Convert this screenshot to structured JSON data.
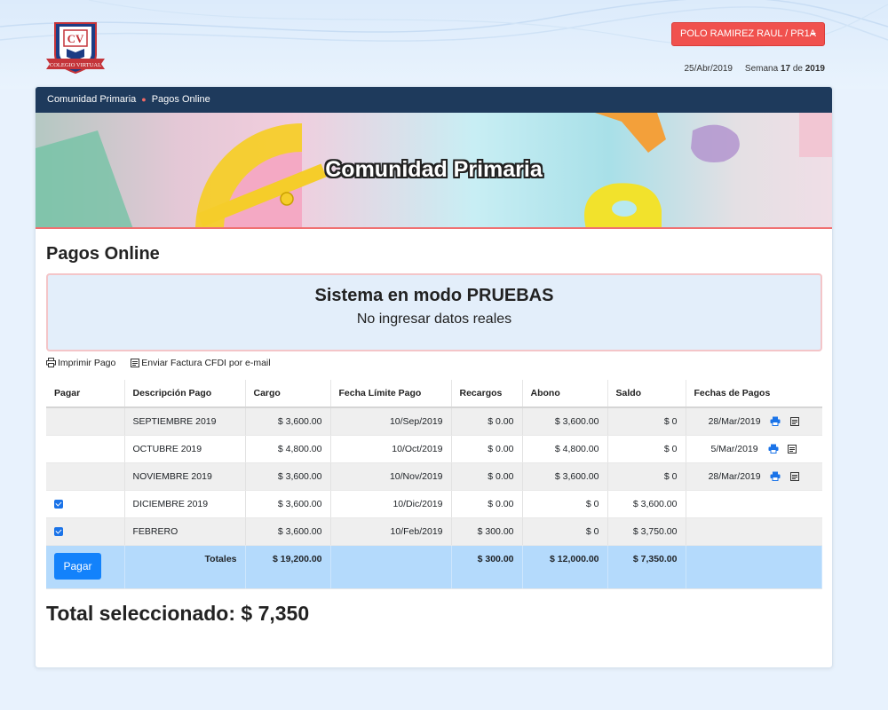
{
  "header": {
    "logo_text": "CV",
    "logo_ribbon": "COLEGIO VIRTUAL",
    "user_button": "POLO RAMIREZ RAUL / PR1A",
    "date": "25/Abr/2019",
    "week_label": "Semana",
    "week_number": "17",
    "week_of": "de",
    "week_year": "2019"
  },
  "breadcrumb": {
    "home": "Comunidad Primaria",
    "current": "Pagos Online"
  },
  "banner": {
    "title": "Comunidad Primaria"
  },
  "page": {
    "title": "Pagos Online"
  },
  "alert": {
    "title": "Sistema en modo PRUEBAS",
    "message": "No ingresar datos reales"
  },
  "actions": {
    "print": "Imprimir Pago",
    "email": "Enviar Factura CFDI por e-mail"
  },
  "table": {
    "headers": [
      "Pagar",
      "Descripción Pago",
      "Cargo",
      "Fecha Límite Pago",
      "Recargos",
      "Abono",
      "Saldo",
      "Fechas de Pagos"
    ],
    "rows": [
      {
        "pagar": false,
        "descripcion": "SEPTIEMBRE 2019",
        "cargo": "$ 3,600.00",
        "fecha": "10/Sep/2019",
        "recargos": "$ 0.00",
        "abono": "$ 3,600.00",
        "saldo": "$ 0",
        "fecha_pago": "28/Mar/2019"
      },
      {
        "pagar": false,
        "descripcion": "OCTUBRE 2019",
        "cargo": "$ 4,800.00",
        "fecha": "10/Oct/2019",
        "recargos": "$ 0.00",
        "abono": "$ 4,800.00",
        "saldo": "$ 0",
        "fecha_pago": "5/Mar/2019"
      },
      {
        "pagar": false,
        "descripcion": "NOVIEMBRE 2019",
        "cargo": "$ 3,600.00",
        "fecha": "10/Nov/2019",
        "recargos": "$ 0.00",
        "abono": "$ 3,600.00",
        "saldo": "$ 0",
        "fecha_pago": "28/Mar/2019"
      },
      {
        "pagar": true,
        "descripcion": "DICIEMBRE 2019",
        "cargo": "$ 3,600.00",
        "fecha": "10/Dic/2019",
        "recargos": "$ 0.00",
        "abono": "$ 0",
        "saldo": "$ 3,600.00",
        "fecha_pago": ""
      },
      {
        "pagar": true,
        "descripcion": "FEBRERO",
        "cargo": "$ 3,600.00",
        "fecha": "10/Feb/2019",
        "recargos": "$ 300.00",
        "abono": "$ 0",
        "saldo": "$ 3,750.00",
        "fecha_pago": ""
      }
    ],
    "totals": {
      "button": "Pagar",
      "label": "Totales",
      "cargo": "$ 19,200.00",
      "recargos": "$ 300.00",
      "abono": "$ 12,000.00",
      "saldo": "$ 7,350.00"
    }
  },
  "total_selected": "Total seleccionado: $ 7,350",
  "colors": {
    "navbar": "#1e3a5c",
    "user_button": "#f0514e",
    "primary": "#1382fb",
    "totals_row": "#b4dafc",
    "alert_bg": "#e3eefa"
  },
  "icons": [
    "printer-icon",
    "email-icon",
    "checkbox-checked-icon",
    "caret-down-icon"
  ]
}
